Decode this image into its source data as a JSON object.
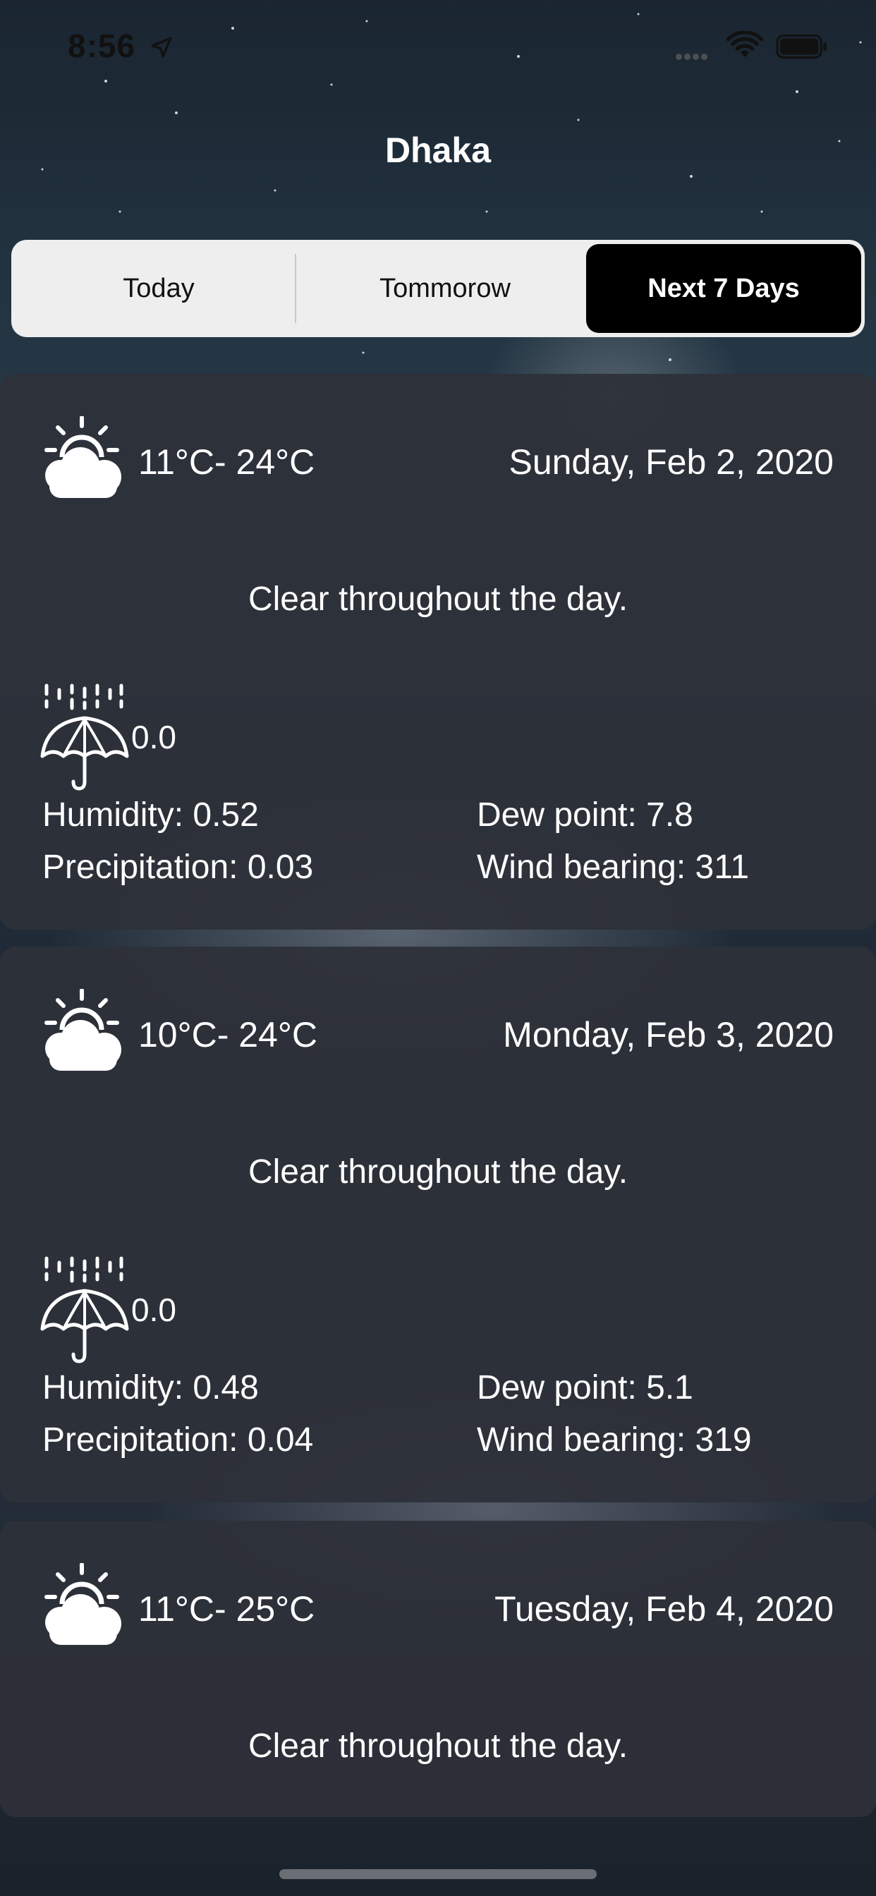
{
  "status_bar": {
    "time": "8:56",
    "icons": [
      "location-arrow-icon",
      "signal-icon",
      "wifi-icon",
      "battery-icon"
    ]
  },
  "header": {
    "city": "Dhaka"
  },
  "segments": {
    "items": [
      "Today",
      "Tommorow",
      "Next 7 Days"
    ],
    "selected_index": 2
  },
  "forecast": [
    {
      "icon": "partly-cloudy-day-icon",
      "temp_range": "11°C- 24°C",
      "date": "Sunday, Feb 2, 2020",
      "summary": "Clear throughout the day.",
      "rain_icon": "umbrella-rain-icon",
      "rain_value": "0.0",
      "humidity": "Humidity: 0.52",
      "dew_point": "Dew point: 7.8",
      "precipitation": "Precipitation: 0.03",
      "wind_bearing": "Wind bearing: 311"
    },
    {
      "icon": "partly-cloudy-day-icon",
      "temp_range": "10°C- 24°C",
      "date": "Monday, Feb 3, 2020",
      "summary": "Clear throughout the day.",
      "rain_icon": "umbrella-rain-icon",
      "rain_value": "0.0",
      "humidity": "Humidity: 0.48",
      "dew_point": "Dew point: 5.1",
      "precipitation": "Precipitation: 0.04",
      "wind_bearing": "Wind bearing: 319"
    },
    {
      "icon": "partly-cloudy-day-icon",
      "temp_range": "11°C- 25°C",
      "date": "Tuesday, Feb 4, 2020",
      "summary": "Clear throughout the day."
    }
  ],
  "colors": {
    "card_background": "#2d3039",
    "segment_background": "#eeeeee",
    "segment_selected": "#000000",
    "text": "#ffffff"
  }
}
